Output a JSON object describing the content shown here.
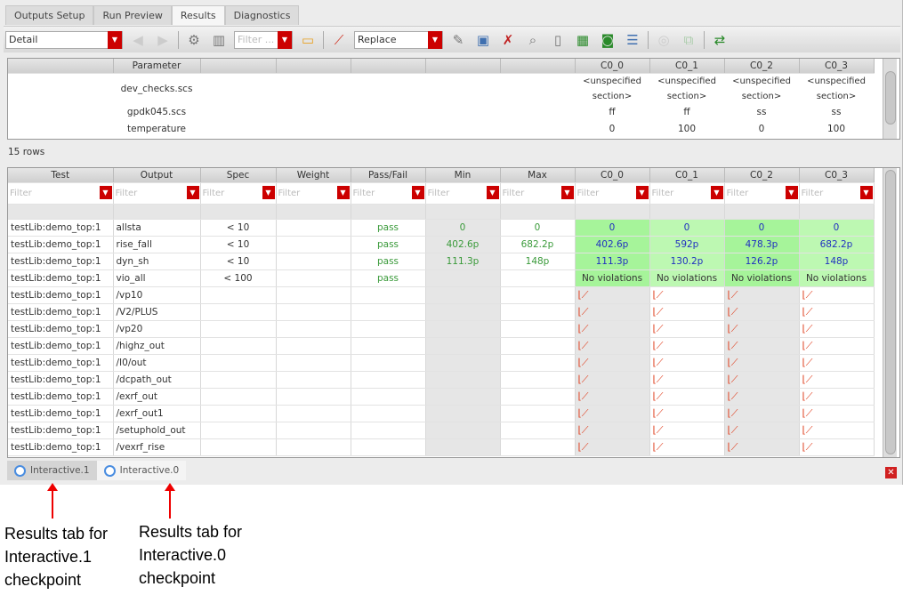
{
  "tabs": [
    "Outputs Setup",
    "Run Preview",
    "Results",
    "Diagnostics"
  ],
  "toolbar": {
    "view": "Detail",
    "filter_placeholder": "Filter ...",
    "mode": "Replace"
  },
  "top_table": {
    "headers": [
      "",
      "Parameter",
      "",
      "",
      "",
      "",
      "",
      "C0_0",
      "C0_1",
      "C0_2",
      "C0_3"
    ],
    "rows": [
      {
        "param": "dev_checks.scs",
        "vals": [
          "<unspecified section>",
          "<unspecified section>",
          "<unspecified section>",
          "<unspecified section>"
        ]
      },
      {
        "param": "gpdk045.scs",
        "vals": [
          "ff",
          "ff",
          "ss",
          "ss"
        ]
      },
      {
        "param": "temperature",
        "vals": [
          "0",
          "100",
          "0",
          "100"
        ]
      }
    ]
  },
  "row_count": "15 rows",
  "results": {
    "headers": [
      "Test",
      "Output",
      "Spec",
      "Weight",
      "Pass/Fail",
      "Min",
      "Max",
      "C0_0",
      "C0_1",
      "C0_2",
      "C0_3"
    ],
    "filter_placeholder": "Filter",
    "rows": [
      {
        "test": "testLib:demo_top:1",
        "output": "allsta",
        "spec": "< 10",
        "weight": "",
        "pf": "pass",
        "min": "0",
        "max": "0",
        "c": [
          "0",
          "0",
          "0",
          "0"
        ]
      },
      {
        "test": "testLib:demo_top:1",
        "output": "rise_fall",
        "spec": "< 10",
        "weight": "",
        "pf": "pass",
        "min": "402.6p",
        "max": "682.2p",
        "c": [
          "402.6p",
          "592p",
          "478.3p",
          "682.2p"
        ]
      },
      {
        "test": "testLib:demo_top:1",
        "output": "dyn_sh",
        "spec": "< 10",
        "weight": "",
        "pf": "pass",
        "min": "111.3p",
        "max": "148p",
        "c": [
          "111.3p",
          "130.2p",
          "126.2p",
          "148p"
        ]
      },
      {
        "test": "testLib:demo_top:1",
        "output": "vio_all",
        "spec": "< 100",
        "weight": "",
        "pf": "pass",
        "min": "",
        "max": "",
        "c": [
          "No violations",
          "No violations",
          "No violations",
          "No violations"
        ]
      },
      {
        "test": "testLib:demo_top:1",
        "output": "/vp10",
        "plot": true
      },
      {
        "test": "testLib:demo_top:1",
        "output": "/V2/PLUS",
        "plot": true
      },
      {
        "test": "testLib:demo_top:1",
        "output": "/vp20",
        "plot": true
      },
      {
        "test": "testLib:demo_top:1",
        "output": "/highz_out",
        "plot": true
      },
      {
        "test": "testLib:demo_top:1",
        "output": "/I0/out",
        "plot": true
      },
      {
        "test": "testLib:demo_top:1",
        "output": "/dcpath_out",
        "plot": true
      },
      {
        "test": "testLib:demo_top:1",
        "output": "/exrf_out",
        "plot": true
      },
      {
        "test": "testLib:demo_top:1",
        "output": "/exrf_out1",
        "plot": true
      },
      {
        "test": "testLib:demo_top:1",
        "output": "/setuphold_out",
        "plot": true
      },
      {
        "test": "testLib:demo_top:1",
        "output": "/vexrf_rise",
        "plot": true
      }
    ]
  },
  "bottom_tabs": [
    "Interactive.1",
    "Interactive.0"
  ],
  "annotations": [
    "Results tab for Interactive.1 checkpoint",
    "Results tab for Interactive.0 checkpoint"
  ]
}
